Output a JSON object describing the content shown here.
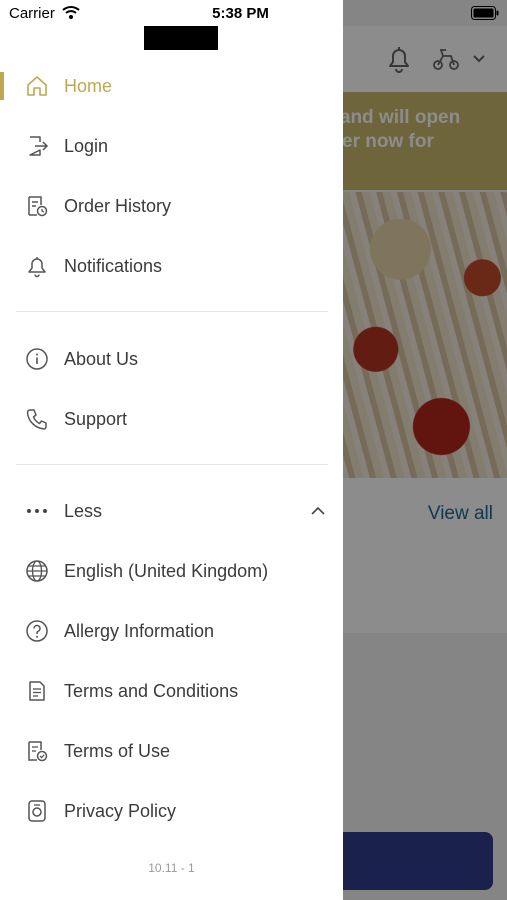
{
  "status_bar": {
    "carrier": "Carrier",
    "time": "5:38 PM"
  },
  "drawer": {
    "primary": [
      {
        "label": "Home",
        "icon": "home-icon",
        "active": true
      },
      {
        "label": "Login",
        "icon": "login-icon"
      },
      {
        "label": "Order History",
        "icon": "order-history-icon"
      },
      {
        "label": "Notifications",
        "icon": "bell-icon"
      }
    ],
    "secondary": [
      {
        "label": "About Us",
        "icon": "info-icon"
      },
      {
        "label": "Support",
        "icon": "phone-icon"
      }
    ],
    "more_toggle": {
      "label": "Less",
      "icon": "more-dots-icon"
    },
    "tertiary": [
      {
        "label": "English (United Kingdom)",
        "icon": "globe-icon"
      },
      {
        "label": "Allergy Information",
        "icon": "question-icon"
      },
      {
        "label": "Terms and Conditions",
        "icon": "document-icon"
      },
      {
        "label": "Terms of Use",
        "icon": "document-check-icon"
      },
      {
        "label": "Privacy Policy",
        "icon": "privacy-icon"
      }
    ],
    "version": "10.11 - 1"
  },
  "background": {
    "banner_lines": [
      "d and will open",
      "rder now for"
    ],
    "view_all": "View all"
  },
  "colors": {
    "accent": "#bfa84f",
    "text": "#3b3b3b",
    "banner": "#c9b86a",
    "cta": "#2f3d8a",
    "link": "#1f6a8f"
  }
}
